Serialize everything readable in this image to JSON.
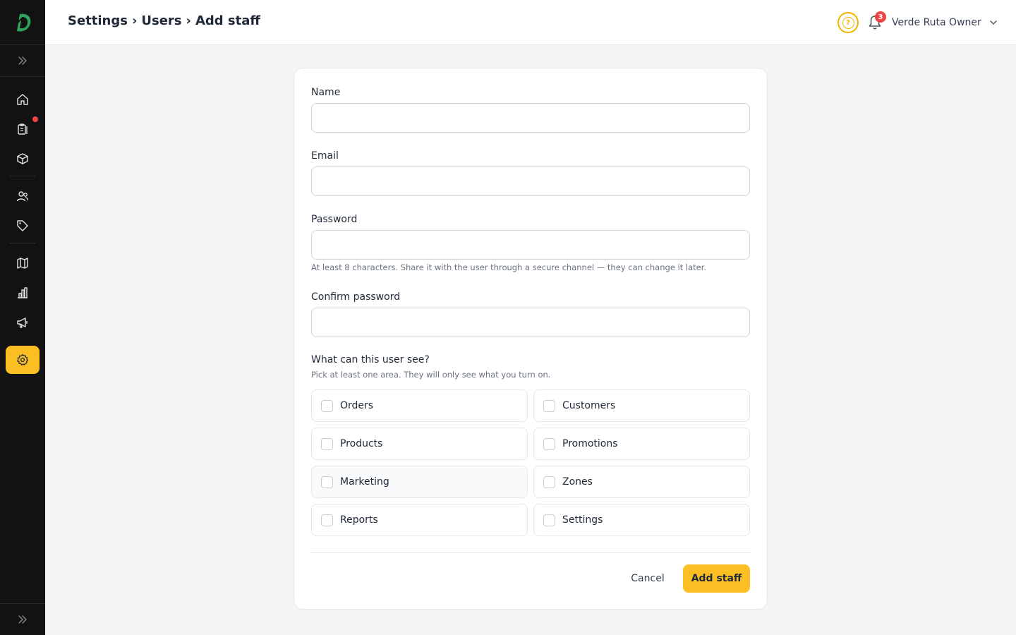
{
  "header": {
    "breadcrumb": [
      "Settings",
      "›",
      "Users",
      "›",
      "Add staff"
    ],
    "help_icon": "question-circle-icon",
    "notifications_count": "3",
    "user_name": "Verde Ruta Owner"
  },
  "sidebar": {
    "items": [
      {
        "name": "home",
        "icon": "home-icon"
      },
      {
        "name": "orders",
        "icon": "clipboard-icon",
        "has_dot": true
      },
      {
        "name": "products",
        "icon": "box-icon"
      },
      {
        "name": "customers",
        "icon": "users-icon"
      },
      {
        "name": "promotions",
        "icon": "tag-icon"
      },
      {
        "name": "zones",
        "icon": "map-icon"
      },
      {
        "name": "reports",
        "icon": "bar-chart-icon"
      },
      {
        "name": "marketing",
        "icon": "megaphone-icon"
      },
      {
        "name": "settings",
        "icon": "gear-icon",
        "active": true
      }
    ],
    "accent_color": "#fbbf24"
  },
  "form": {
    "name_label": "Name",
    "name_value": "",
    "email_label": "Email",
    "email_value": "",
    "password_label": "Password",
    "password_value": "",
    "password_hint": "At least 8 characters. Share it with the user through a secure channel — they can change it later.",
    "confirm_label": "Confirm password",
    "confirm_value": "",
    "permissions_title": "What can this user see?",
    "permissions_subtitle": "Pick at least one area. They will only see what you turn on.",
    "permissions": [
      {
        "label": "Orders",
        "checked": false
      },
      {
        "label": "Customers",
        "checked": false
      },
      {
        "label": "Products",
        "checked": false
      },
      {
        "label": "Promotions",
        "checked": false
      },
      {
        "label": "Marketing",
        "checked": false
      },
      {
        "label": "Zones",
        "checked": false
      },
      {
        "label": "Reports",
        "checked": false
      },
      {
        "label": "Settings",
        "checked": false
      }
    ],
    "cancel_label": "Cancel",
    "submit_label": "Add staff"
  }
}
